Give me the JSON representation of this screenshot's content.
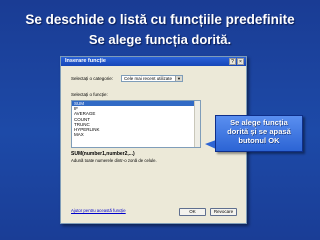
{
  "slide": {
    "title": "Se deschide o listă cu  funcțiile predefinite",
    "subtitle": "Se alege funcția dorită."
  },
  "dialog": {
    "title": "Inserare funcție",
    "close_glyph": "×",
    "help_glyph": "?",
    "category_label": "Selectați o categorie:",
    "category_value": "Cele mai recent utilizate",
    "function_label": "Selectați o funcție:",
    "functions": [
      "SUM",
      "IF",
      "AVERAGE",
      "COUNT",
      "TRUNC",
      "HYPERLINK",
      "MAX"
    ],
    "selected_function": "SUM",
    "signature": "SUM(number1,number2,...)",
    "description": "Adună toate numerele dintr-o zonă de celule.",
    "help_link": "Ajutor pentru această funcție",
    "ok_label": "OK",
    "cancel_label": "Revocare"
  },
  "callout": {
    "line1": "Se alege funcția",
    "line2": "dorită  şi se apasă",
    "line3": "butonul  OK"
  }
}
